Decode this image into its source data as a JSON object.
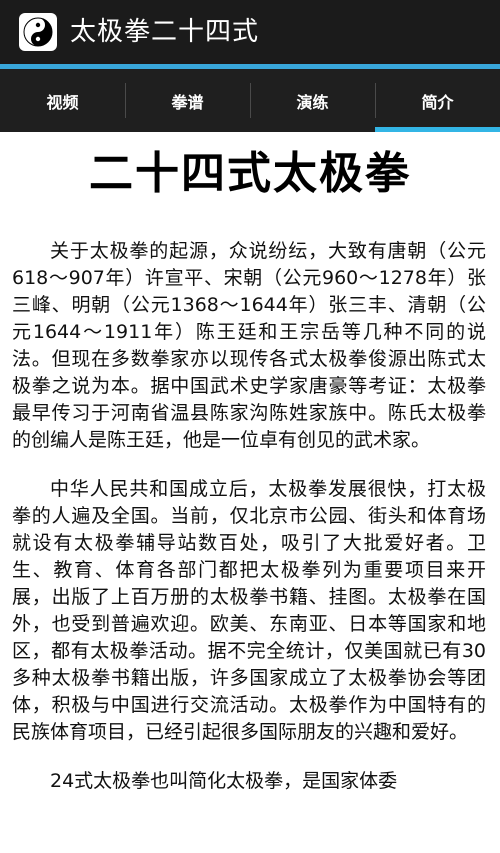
{
  "app": {
    "title": "太极拳二十四式",
    "icon": "yin-yang-logo"
  },
  "colors": {
    "appbar": "#1b1b1b",
    "accent": "#39a7db",
    "tab_indicator": "#33b5e5"
  },
  "tabs": [
    {
      "label": "视频",
      "active": false
    },
    {
      "label": "拳谱",
      "active": false
    },
    {
      "label": "演练",
      "active": false
    },
    {
      "label": "简介",
      "active": true
    }
  ],
  "article": {
    "title": "二十四式太极拳",
    "paragraphs": [
      "关于太极拳的起源，众说纷纭，大致有唐朝（公元618～907年）许宣平、宋朝（公元960～1278年）张三峰、明朝（公元1368～1644年）张三丰、清朝（公元1644～1911年）陈王廷和王宗岳等几种不同的说法。但现在多数拳家亦以现传各式太极拳俊源出陈式太极拳之说为本。据中国武术史学家唐豪等考证：太极拳最早传习于河南省温县陈家沟陈姓家族中。陈氏太极拳的创编人是陈王廷，他是一位卓有创见的武术家。",
      "中华人民共和国成立后，太极拳发展很快，打太极拳的人遍及全国。当前，仅北京市公园、街头和体育场就设有太极拳辅导站数百处，吸引了大批爱好者。卫生、教育、体育各部门都把太极拳列为重要项目来开展，出版了上百万册的太极拳书籍、挂图。太极拳在国外，也受到普遍欢迎。欧美、东南亚、日本等国家和地区，都有太极拳活动。据不完全统计，仅美国就已有30多种太极拳书籍出版，许多国家成立了太极拳协会等团体，积极与中国进行交流活动。太极拳作为中国特有的民族体育项目，已经引起很多国际朋友的兴趣和爱好。",
      "24式太极拳也叫简化太极拳，是国家体委"
    ]
  }
}
